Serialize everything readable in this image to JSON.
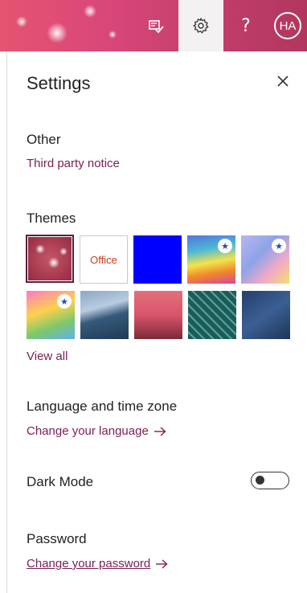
{
  "header": {
    "avatar_initials": "HA",
    "help_label": "?",
    "icons": [
      "tasks-icon",
      "settings-gear-icon",
      "help-icon",
      "avatar"
    ],
    "accent": "#d9477a"
  },
  "panel": {
    "title": "Settings",
    "other": {
      "heading": "Other",
      "link": "Third party notice"
    },
    "themes": {
      "heading": "Themes",
      "office_label": "Office",
      "view_all": "View all",
      "items": [
        {
          "name": "bokeh-pink",
          "selected": true
        },
        {
          "name": "office"
        },
        {
          "name": "blue"
        },
        {
          "name": "rainbow",
          "starred": true
        },
        {
          "name": "swirl",
          "starred": true
        },
        {
          "name": "unicorn",
          "starred": true
        },
        {
          "name": "mountains"
        },
        {
          "name": "palm-sunset"
        },
        {
          "name": "circuit"
        },
        {
          "name": "blueprint"
        }
      ]
    },
    "language": {
      "heading": "Language and time zone",
      "link": "Change your language"
    },
    "dark_mode": {
      "heading": "Dark Mode",
      "enabled": false
    },
    "password": {
      "heading": "Password",
      "link": "Change your password"
    },
    "link_color": "#7a1e55"
  }
}
